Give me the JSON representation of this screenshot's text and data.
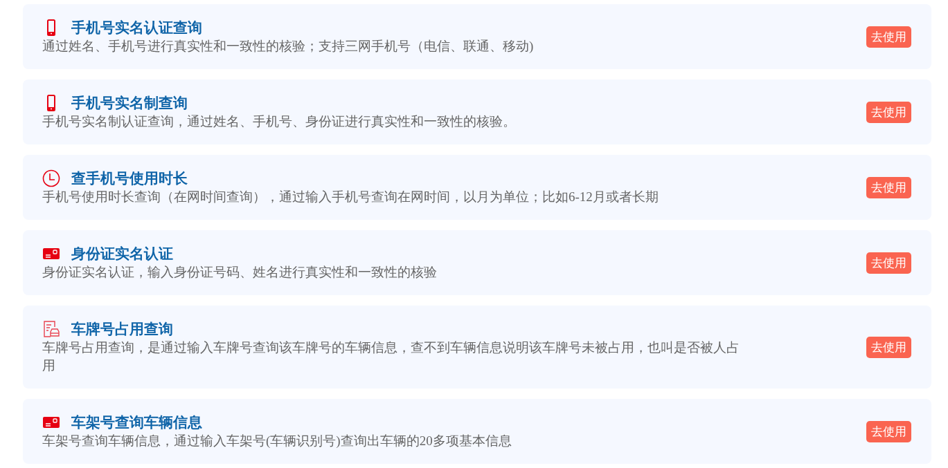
{
  "services": [
    {
      "kind": "phone",
      "title": "手机号实名认证查询",
      "description": "通过姓名、手机号进行真实性和一致性的核验；支持三网手机号（电信、联通、移动)",
      "button": "去使用"
    },
    {
      "kind": "phone",
      "title": "手机号实名制查询",
      "description": "手机号实名制认证查询，通过姓名、手机号、身份证进行真实性和一致性的核验。",
      "button": "去使用"
    },
    {
      "kind": "clock",
      "title": "查手机号使用时长",
      "description": "手机号使用时长查询（在网时间查询），通过输入手机号查询在网时间，以月为单位；比如6-12月或者长期",
      "button": "去使用"
    },
    {
      "kind": "card",
      "title": "身份证实名认证",
      "description": "身份证实名认证，输入身份证号码、姓名进行真实性和一致性的核验",
      "button": "去使用"
    },
    {
      "kind": "car",
      "title": "车牌号占用查询",
      "description": "车牌号占用查询，是通过输入车牌号查询该车牌号的车辆信息，查不到车辆信息说明该车牌号未被占用，也叫是否被人占用",
      "button": "去使用"
    },
    {
      "kind": "card",
      "title": "车架号查询车辆信息",
      "description": "车架号查询车辆信息，通过输入车架号(车辆识别号)查询出车辆的20多项基本信息",
      "button": "去使用"
    }
  ]
}
